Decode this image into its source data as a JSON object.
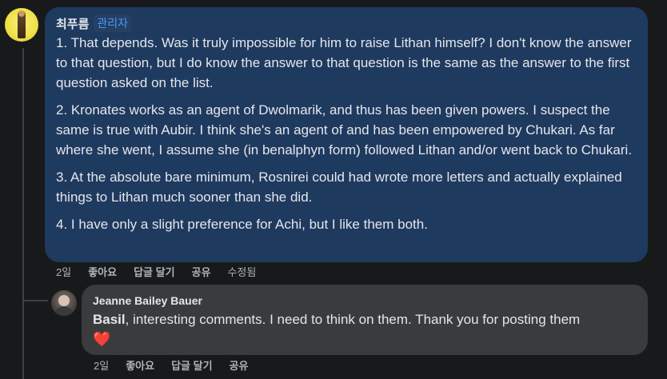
{
  "main_comment": {
    "author": "최푸름",
    "badge": "관리자",
    "paragraphs": [
      "1. That depends. Was it truly impossible for him to raise Lithan himself? I don't know the answer to that question, but I do know the answer to that question is the same as the answer to the first question asked on the list.",
      "2. Kronates works as an agent of Dwolmarik, and thus has been given powers. I suspect the same is true with Aubir. I think she's an agent of and has been empowered by Chukari. As far where she went, I assume she (in benalphyn form) followed Lithan and/or went back to Chukari.",
      "3. At the absolute bare minimum, Rosnirei could had wrote more letters and actually explained things to Lithan much sooner than she did.",
      "4. I have only a slight preference for Achi, but I like them both."
    ],
    "actions": {
      "time": "2일",
      "like": "좋아요",
      "reply": "답글 달기",
      "share": "공유",
      "edited": "수정됨"
    }
  },
  "reply_comment": {
    "author": "Jeanne Bailey Bauer",
    "mention": "Basil",
    "text": ", interesting comments. I need to think on them. Thank you for posting them",
    "emoji": "❤️",
    "actions": {
      "time": "2일",
      "like": "좋아요",
      "reply": "답글 달기",
      "share": "공유"
    }
  },
  "colors": {
    "background": "#18191a",
    "main_bubble": "#1f3a5f",
    "reply_bubble": "#3a3b3c",
    "badge_text": "#4599ff",
    "muted_text": "#b0b3b8"
  }
}
